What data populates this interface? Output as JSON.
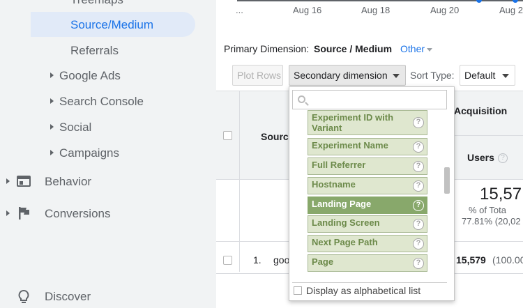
{
  "sidebar": {
    "top_item": "Treemaps",
    "active_item": "Source/Medium",
    "referrals": "Referrals",
    "groups": [
      "Google Ads",
      "Search Console",
      "Social",
      "Campaigns"
    ],
    "sections": [
      "Behavior",
      "Conversions"
    ],
    "discover": "Discover"
  },
  "timeline": {
    "ellipsis": "...",
    "ticks": [
      "Aug 16",
      "Aug 18",
      "Aug 20",
      "Aug 2"
    ]
  },
  "primary_dimension": {
    "label": "Primary Dimension:",
    "current": "Source / Medium",
    "other": "Other"
  },
  "toolbar": {
    "plot_rows": "Plot Rows",
    "secondary_dimension": "Secondary dimension",
    "sort_type_label": "Sort Type:",
    "sort_type_value": "Default"
  },
  "table": {
    "source_header": "Source",
    "acquisition_header": "Acquisition",
    "users_header": "Users",
    "total_value": "15,57",
    "total_pct": "% of Tota",
    "total_sub": "77.81% (20,02",
    "rows": [
      {
        "num": "1.",
        "source": "goo",
        "value": "15,579",
        "pct": "(100.00"
      }
    ]
  },
  "dropdown": {
    "search_placeholder": "",
    "options": [
      {
        "label": "Experiment ID with Variant",
        "selected": false
      },
      {
        "label": "Experiment Name",
        "selected": false
      },
      {
        "label": "Full Referrer",
        "selected": false
      },
      {
        "label": "Hostname",
        "selected": false
      },
      {
        "label": "Landing Page",
        "selected": true
      },
      {
        "label": "Landing Screen",
        "selected": false
      },
      {
        "label": "Next Page Path",
        "selected": false
      },
      {
        "label": "Page",
        "selected": false
      }
    ],
    "alphabetical_label": "Display as alphabetical list"
  },
  "colors": {
    "accent": "#1a73e8",
    "option_bg": "#dfe7cf",
    "option_selected_bg": "#88a86b"
  }
}
